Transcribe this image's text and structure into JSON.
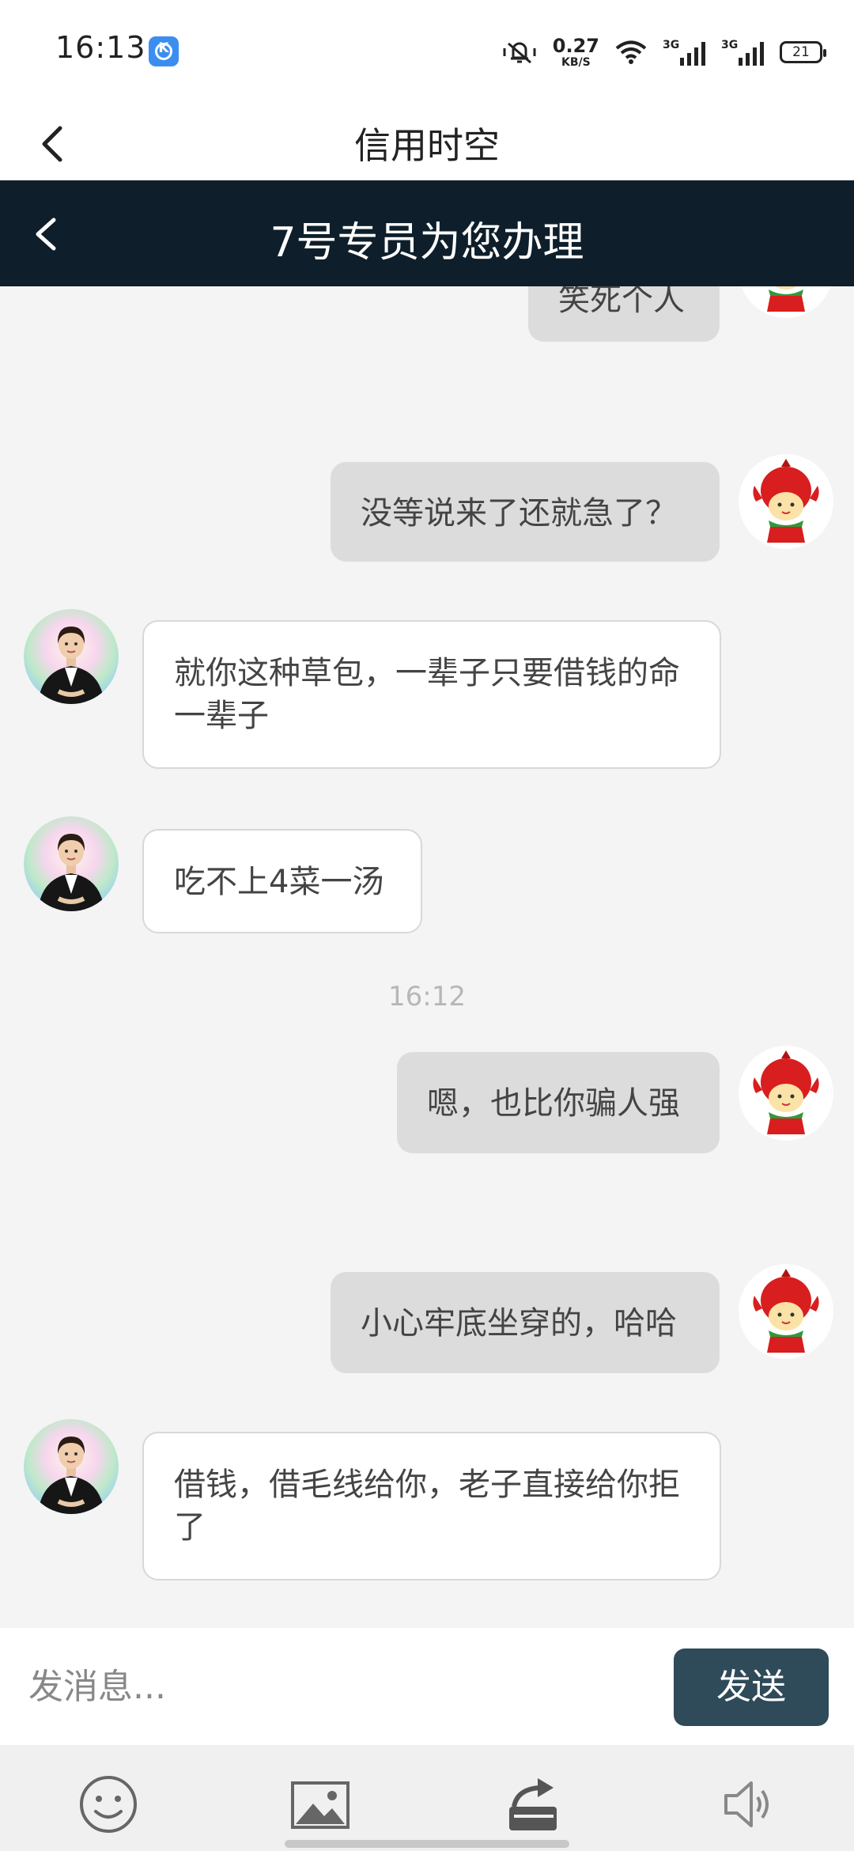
{
  "status_bar": {
    "time": "16:13",
    "app_badge": "K",
    "net_speed_value": "0.27",
    "net_speed_unit": "KB/S",
    "signal1_label": "3G",
    "signal2_label": "3G",
    "battery": "21"
  },
  "title_bar": {
    "title": "信用时空"
  },
  "chat_header": {
    "title": "7号专员为您办理"
  },
  "messages": [
    {
      "side": "out",
      "text": "笑死个人"
    },
    {
      "side": "out",
      "text": "没等说来了还就急了？"
    },
    {
      "side": "in",
      "text": "就你这种草包，一辈子只要借钱的命 一辈子"
    },
    {
      "side": "in",
      "text": "吃不上4菜一汤"
    },
    {
      "side": "out",
      "text": "嗯，也比你骗人强"
    },
    {
      "side": "out",
      "text": "小心牢底坐穿的，哈哈"
    },
    {
      "side": "in",
      "text": "借钱，借毛线给你，老子直接给你拒了"
    }
  ],
  "timestamp": "16:12",
  "input": {
    "placeholder": "发消息...",
    "value": "",
    "send_label": "发送"
  },
  "toolbar": {
    "items": [
      "emoji-icon",
      "image-icon",
      "share-icon",
      "voice-icon"
    ]
  },
  "colors": {
    "dark_header": "#0e1f2b",
    "send_button": "#2f4a59",
    "out_bubble": "#dcdcdc",
    "in_bubble": "#ffffff"
  }
}
